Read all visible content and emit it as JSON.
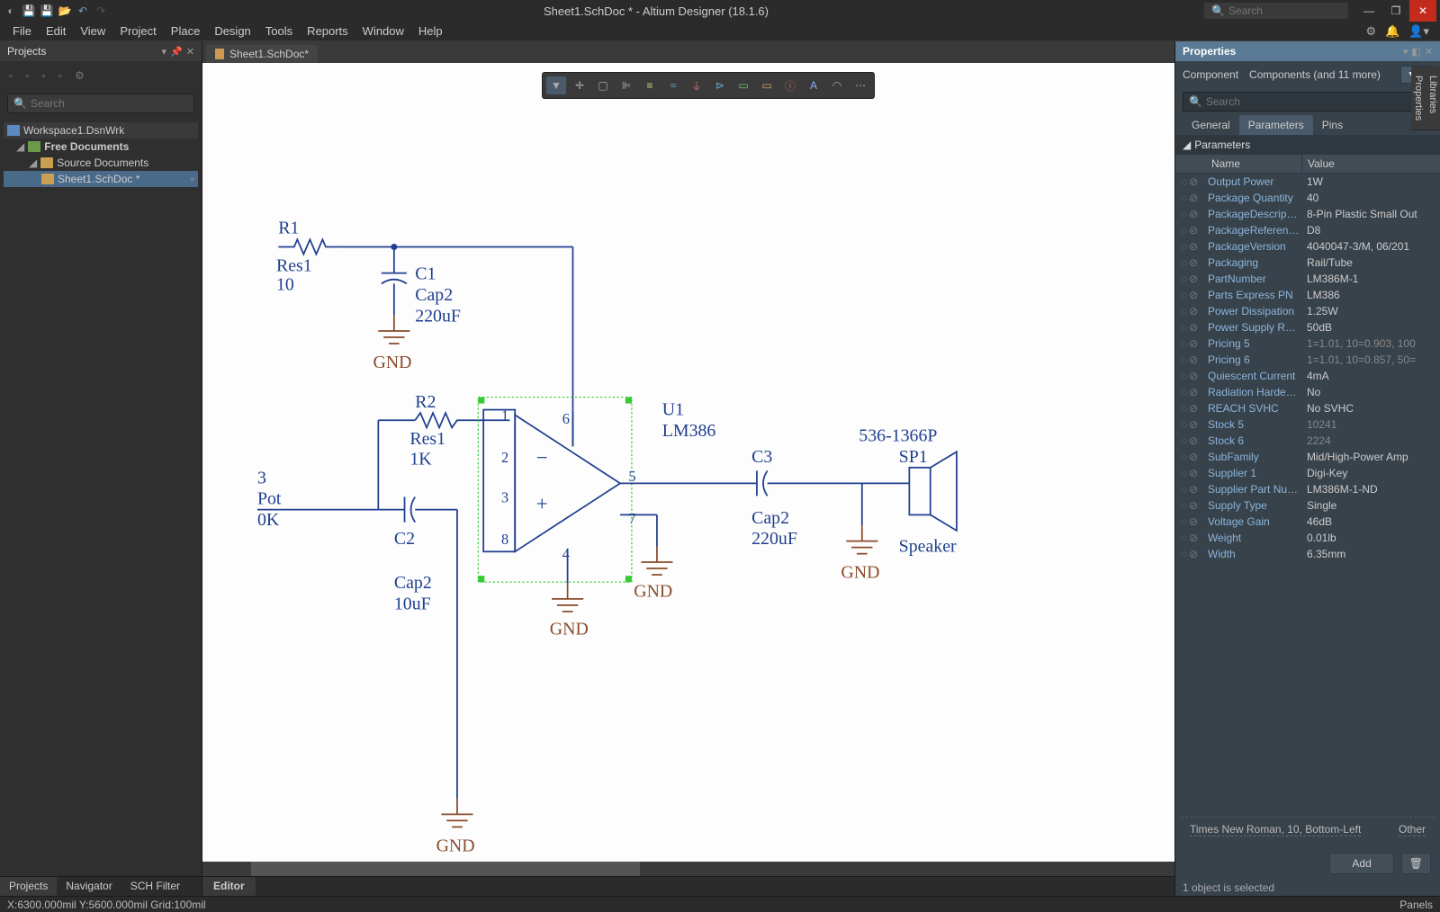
{
  "titlebar": {
    "title": "Sheet1.SchDoc * - Altium Designer (18.1.6)",
    "search_placeholder": "Search"
  },
  "menus": [
    "File",
    "Edit",
    "View",
    "Project",
    "Place",
    "Design",
    "Tools",
    "Reports",
    "Window",
    "Help"
  ],
  "left_panel": {
    "title": "Projects",
    "search_placeholder": "Search",
    "tree": {
      "workspace": "Workspace1.DsnWrk",
      "free_docs": "Free Documents",
      "source_docs": "Source Documents",
      "sheet": "Sheet1.SchDoc *"
    },
    "tabs": [
      "Projects",
      "Navigator",
      "SCH Filter"
    ]
  },
  "doc_tab": "Sheet1.SchDoc*",
  "editor_tab": "Editor",
  "schematic": {
    "r1": {
      "ref": "R1",
      "name": "Res1",
      "val": "10"
    },
    "r2": {
      "ref": "R2",
      "name": "Res1",
      "val": "1K"
    },
    "c1": {
      "ref": "C1",
      "name": "Cap2",
      "val": "220uF"
    },
    "c2": {
      "ref": "C2",
      "name": "Cap2",
      "val": "10uF"
    },
    "c3": {
      "ref": "C3",
      "name": "Cap2",
      "val": "220uF"
    },
    "u1": {
      "ref": "U1",
      "name": "LM386"
    },
    "sp1": {
      "pn": "536-1366P",
      "ref": "SP1",
      "name": "Speaker"
    },
    "pot": {
      "pin": "3",
      "name": "Pot",
      "val": "0K"
    },
    "gnd": "GND",
    "pins": {
      "p1": "1",
      "p2": "2",
      "p3": "3",
      "p4": "4",
      "p5": "5",
      "p6": "6",
      "p7": "7",
      "p8": "8"
    }
  },
  "right_panel": {
    "title": "Properties",
    "selector1": "Component",
    "selector2": "Components (and 11 more)",
    "search_placeholder": "Search",
    "tabs": [
      "General",
      "Parameters",
      "Pins"
    ],
    "active_tab": 1,
    "section": "Parameters",
    "col_name": "Name",
    "col_value": "Value",
    "params": [
      {
        "name": "Output Power",
        "value": "1W"
      },
      {
        "name": "Package Quantity",
        "value": "40"
      },
      {
        "name": "PackageDescription",
        "value": "8-Pin Plastic Small Out"
      },
      {
        "name": "PackageReference",
        "value": "D8"
      },
      {
        "name": "PackageVersion",
        "value": "4040047-3/M, 06/201"
      },
      {
        "name": "Packaging",
        "value": "Rail/Tube"
      },
      {
        "name": "PartNumber",
        "value": "LM386M-1"
      },
      {
        "name": "Parts Express PN",
        "value": "LM386"
      },
      {
        "name": "Power Dissipation",
        "value": "1.25W"
      },
      {
        "name": "Power Supply Rejectio",
        "value": "50dB"
      },
      {
        "name": "Pricing 5",
        "value": "1=1.01, 10=0.903, 100",
        "dim": true
      },
      {
        "name": "Pricing 6",
        "value": "1=1.01, 10=0.857, 50=",
        "dim": true
      },
      {
        "name": "Quiescent Current",
        "value": "4mA"
      },
      {
        "name": "Radiation Hardening",
        "value": "No"
      },
      {
        "name": "REACH SVHC",
        "value": "No SVHC"
      },
      {
        "name": "Stock 5",
        "value": "10241",
        "dim": true
      },
      {
        "name": "Stock 6",
        "value": "2224",
        "dim": true
      },
      {
        "name": "SubFamily",
        "value": "Mid/High-Power Amp"
      },
      {
        "name": "Supplier 1",
        "value": "Digi-Key"
      },
      {
        "name": "Supplier Part Number",
        "value": "LM386M-1-ND"
      },
      {
        "name": "Supply Type",
        "value": "Single"
      },
      {
        "name": "Voltage Gain",
        "value": "46dB"
      },
      {
        "name": "Weight",
        "value": "0.01lb"
      },
      {
        "name": "Width",
        "value": "6.35mm"
      }
    ],
    "font": "Times New Roman, 10, Bottom-Left",
    "other": "Other",
    "add": "Add",
    "selected": "1 object is selected"
  },
  "side_tabs": [
    "Libraries",
    "Properties"
  ],
  "statusbar": {
    "coords": "X:6300.000mil Y:5600.000mil   Grid:100mil",
    "panels": "Panels"
  }
}
